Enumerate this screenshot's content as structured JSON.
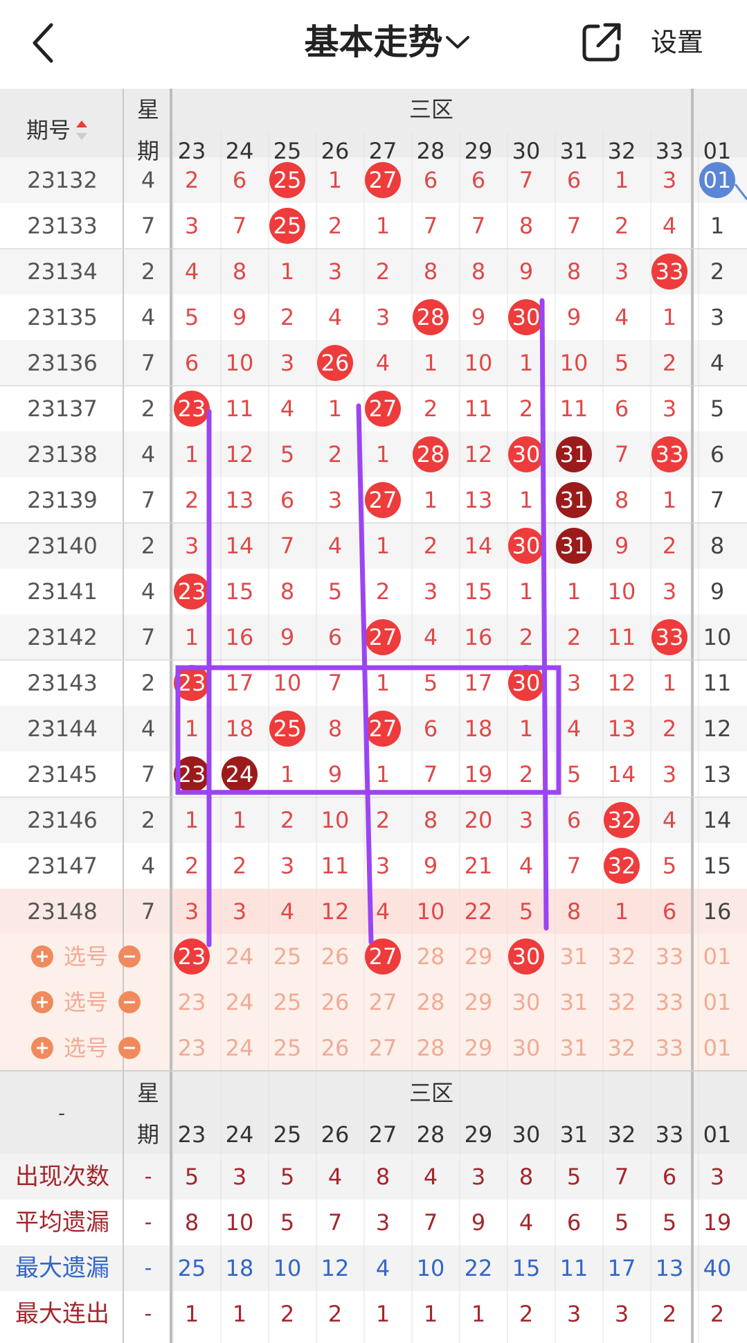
{
  "header": {
    "title": "基本走势",
    "settings_label": "设置",
    "back_icon": "chevron-left-icon",
    "dropdown_icon": "chevron-down-icon",
    "share_icon": "share-external-icon"
  },
  "table": {
    "period_header": "期号",
    "week_header_top": "星",
    "week_header_bottom": "期",
    "zone_label": "三区",
    "columns": [
      "23",
      "24",
      "25",
      "26",
      "27",
      "28",
      "29",
      "30",
      "31",
      "32",
      "33"
    ],
    "extra_column": "01",
    "rows": [
      {
        "period": "23132",
        "week": "4",
        "values": [
          "2",
          "6",
          "25",
          "1",
          "27",
          "6",
          "6",
          "7",
          "6",
          "1",
          "3"
        ],
        "extra": "01"
      },
      {
        "period": "23133",
        "week": "7",
        "values": [
          "3",
          "7",
          "25",
          "2",
          "1",
          "7",
          "7",
          "8",
          "7",
          "2",
          "4"
        ],
        "extra": "1"
      },
      {
        "period": "23134",
        "week": "2",
        "values": [
          "4",
          "8",
          "1",
          "3",
          "2",
          "8",
          "8",
          "9",
          "8",
          "3",
          "33"
        ],
        "extra": "2"
      },
      {
        "period": "23135",
        "week": "4",
        "values": [
          "5",
          "9",
          "2",
          "4",
          "3",
          "28",
          "9",
          "30",
          "9",
          "4",
          "1"
        ],
        "extra": "3"
      },
      {
        "period": "23136",
        "week": "7",
        "values": [
          "6",
          "10",
          "3",
          "26",
          "4",
          "1",
          "10",
          "1",
          "10",
          "5",
          "2"
        ],
        "extra": "4"
      },
      {
        "period": "23137",
        "week": "2",
        "values": [
          "23",
          "11",
          "4",
          "1",
          "27",
          "2",
          "11",
          "2",
          "11",
          "6",
          "3"
        ],
        "extra": "5"
      },
      {
        "period": "23138",
        "week": "4",
        "values": [
          "1",
          "12",
          "5",
          "2",
          "1",
          "28",
          "12",
          "30",
          "31",
          "7",
          "33"
        ],
        "extra": "6"
      },
      {
        "period": "23139",
        "week": "7",
        "values": [
          "2",
          "13",
          "6",
          "3",
          "27",
          "1",
          "13",
          "1",
          "31",
          "8",
          "1"
        ],
        "extra": "7"
      },
      {
        "period": "23140",
        "week": "2",
        "values": [
          "3",
          "14",
          "7",
          "4",
          "1",
          "2",
          "14",
          "30",
          "31",
          "9",
          "2"
        ],
        "extra": "8"
      },
      {
        "period": "23141",
        "week": "4",
        "values": [
          "23",
          "15",
          "8",
          "5",
          "2",
          "3",
          "15",
          "1",
          "1",
          "10",
          "3"
        ],
        "extra": "9"
      },
      {
        "period": "23142",
        "week": "7",
        "values": [
          "1",
          "16",
          "9",
          "6",
          "27",
          "4",
          "16",
          "2",
          "2",
          "11",
          "33"
        ],
        "extra": "10"
      },
      {
        "period": "23143",
        "week": "2",
        "values": [
          "23",
          "17",
          "10",
          "7",
          "1",
          "5",
          "17",
          "30",
          "3",
          "12",
          "1"
        ],
        "extra": "11"
      },
      {
        "period": "23144",
        "week": "4",
        "values": [
          "1",
          "18",
          "25",
          "8",
          "27",
          "6",
          "18",
          "1",
          "4",
          "13",
          "2"
        ],
        "extra": "12"
      },
      {
        "period": "23145",
        "week": "7",
        "values": [
          "23",
          "24",
          "1",
          "9",
          "1",
          "7",
          "19",
          "2",
          "5",
          "14",
          "3"
        ],
        "extra": "13"
      },
      {
        "period": "23146",
        "week": "2",
        "values": [
          "1",
          "1",
          "2",
          "10",
          "2",
          "8",
          "20",
          "3",
          "6",
          "32",
          "4"
        ],
        "extra": "14"
      },
      {
        "period": "23147",
        "week": "4",
        "values": [
          "2",
          "2",
          "3",
          "11",
          "3",
          "9",
          "21",
          "4",
          "7",
          "32",
          "5"
        ],
        "extra": "15"
      },
      {
        "period": "23148",
        "week": "7",
        "values": [
          "3",
          "3",
          "4",
          "12",
          "4",
          "10",
          "22",
          "5",
          "8",
          "1",
          "6"
        ],
        "extra": "16"
      }
    ],
    "hits": [
      {
        "row": 0,
        "col": 2,
        "kind": "red"
      },
      {
        "row": 0,
        "col": 4,
        "kind": "red"
      },
      {
        "row": 0,
        "col": 11,
        "kind": "blue"
      },
      {
        "row": 1,
        "col": 2,
        "kind": "red"
      },
      {
        "row": 2,
        "col": 10,
        "kind": "red"
      },
      {
        "row": 3,
        "col": 5,
        "kind": "red"
      },
      {
        "row": 3,
        "col": 7,
        "kind": "red"
      },
      {
        "row": 4,
        "col": 3,
        "kind": "red"
      },
      {
        "row": 5,
        "col": 0,
        "kind": "red"
      },
      {
        "row": 5,
        "col": 4,
        "kind": "red"
      },
      {
        "row": 6,
        "col": 5,
        "kind": "red"
      },
      {
        "row": 6,
        "col": 7,
        "kind": "red"
      },
      {
        "row": 6,
        "col": 8,
        "kind": "dark"
      },
      {
        "row": 6,
        "col": 10,
        "kind": "red"
      },
      {
        "row": 7,
        "col": 4,
        "kind": "red"
      },
      {
        "row": 7,
        "col": 8,
        "kind": "dark"
      },
      {
        "row": 8,
        "col": 7,
        "kind": "red"
      },
      {
        "row": 8,
        "col": 8,
        "kind": "dark"
      },
      {
        "row": 9,
        "col": 0,
        "kind": "red"
      },
      {
        "row": 10,
        "col": 4,
        "kind": "red"
      },
      {
        "row": 10,
        "col": 10,
        "kind": "red"
      },
      {
        "row": 11,
        "col": 0,
        "kind": "red"
      },
      {
        "row": 11,
        "col": 7,
        "kind": "red"
      },
      {
        "row": 12,
        "col": 2,
        "kind": "red"
      },
      {
        "row": 12,
        "col": 4,
        "kind": "red"
      },
      {
        "row": 13,
        "col": 0,
        "kind": "dark"
      },
      {
        "row": 13,
        "col": 1,
        "kind": "dark"
      },
      {
        "row": 14,
        "col": 9,
        "kind": "red"
      },
      {
        "row": 15,
        "col": 9,
        "kind": "red"
      }
    ],
    "pick_label": "选号",
    "pick_selected": [
      [
        0,
        4,
        7
      ],
      [],
      []
    ],
    "stats": [
      {
        "label": "出现次数",
        "dash": "-",
        "values": [
          "5",
          "3",
          "5",
          "4",
          "8",
          "4",
          "3",
          "8",
          "5",
          "7",
          "6"
        ],
        "extra": "3",
        "color": "#a4262c"
      },
      {
        "label": "平均遗漏",
        "dash": "-",
        "values": [
          "8",
          "10",
          "5",
          "7",
          "3",
          "7",
          "9",
          "4",
          "6",
          "5",
          "5"
        ],
        "extra": "19",
        "color": "#a4262c"
      },
      {
        "label": "最大遗漏",
        "dash": "-",
        "values": [
          "25",
          "18",
          "10",
          "12",
          "4",
          "10",
          "22",
          "15",
          "11",
          "17",
          "13"
        ],
        "extra": "40",
        "color": "#3066c9"
      },
      {
        "label": "最大连出",
        "dash": "-",
        "values": [
          "1",
          "1",
          "2",
          "2",
          "1",
          "1",
          "1",
          "2",
          "3",
          "3",
          "2"
        ],
        "extra": "2",
        "color": "#a4262c"
      }
    ],
    "footer_period_label": "-"
  },
  "colors": {
    "red_ball": "#ee3b3b",
    "dark_ball": "#9b1b1b",
    "blue_ball": "#5b86d6",
    "number_red": "#e04848",
    "text_gray": "#555555",
    "header_bg": "#ececec",
    "pick_bg": "#fdf0ea",
    "pick_text": "#f1aa95",
    "pick_icon": "#f08a5d",
    "overlay_purple": "#9b45f2"
  }
}
